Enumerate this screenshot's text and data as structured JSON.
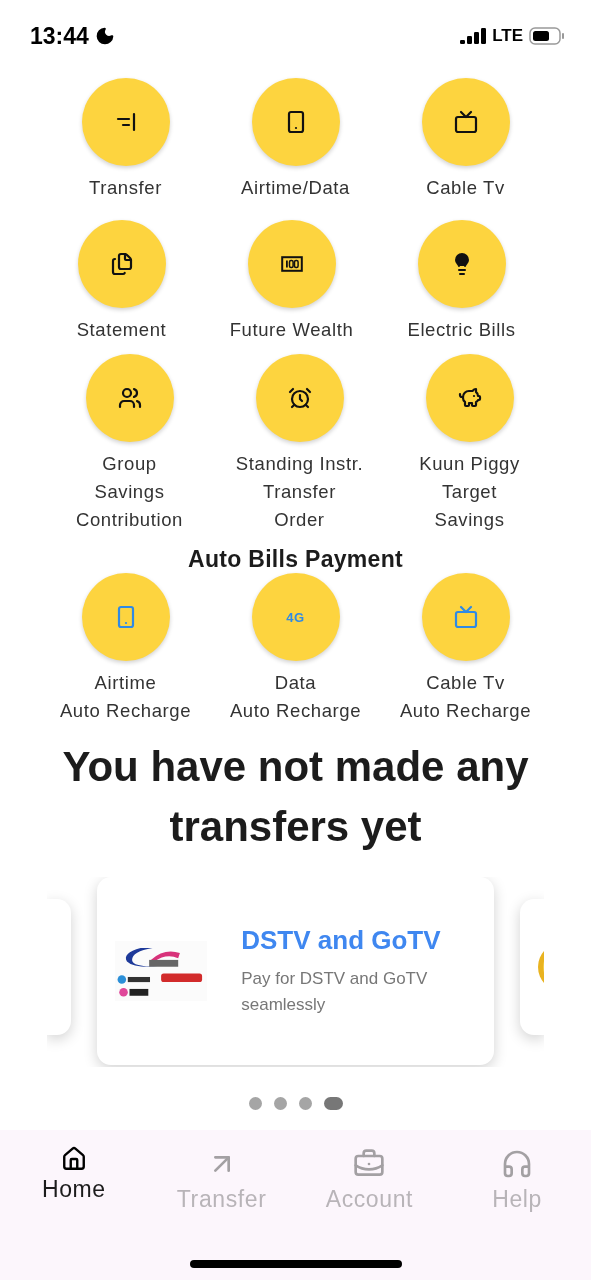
{
  "status_bar": {
    "time": "13:44",
    "network": "LTE"
  },
  "quick_actions": [
    {
      "label": "Transfer"
    },
    {
      "label": "Airtime/Data"
    },
    {
      "label": "Cable Tv"
    },
    {
      "label": "Statement"
    },
    {
      "label": "Future Wealth"
    },
    {
      "label": "Electric Bills"
    },
    {
      "label": "Group\nSavings\nContribution"
    },
    {
      "label": "Standing Instr.\nTransfer\nOrder"
    },
    {
      "label": "Kuun Piggy\nTarget\nSavings"
    }
  ],
  "auto_bills": {
    "title": "Auto Bills Payment",
    "items": [
      {
        "label": "Airtime\nAuto Recharge"
      },
      {
        "label": "Data\nAuto Recharge",
        "icon_text": "4G"
      },
      {
        "label": "Cable Tv\nAuto Recharge"
      }
    ]
  },
  "empty_message": "You have not made any transfers yet",
  "carousel": {
    "card": {
      "title": "DSTV and GoTV",
      "description": "Pay for DSTV and GoTV seamlessly"
    },
    "dots": [
      {
        "selected": false
      },
      {
        "selected": false
      },
      {
        "selected": false
      },
      {
        "selected": true
      }
    ]
  },
  "bottom_nav": [
    {
      "label": "Home",
      "selected": true
    },
    {
      "label": "Transfer",
      "selected": false
    },
    {
      "label": "Account",
      "selected": false
    },
    {
      "label": "Help",
      "selected": false
    }
  ]
}
